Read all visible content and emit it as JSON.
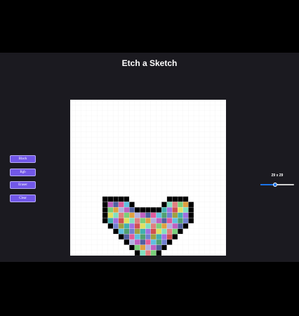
{
  "app": {
    "title": "Etch a Sketch"
  },
  "buttons": {
    "black": "Black",
    "rgb": "Rgb",
    "eraser": "Eraser",
    "clear": "Clear"
  },
  "grid": {
    "size_label": "29 x 29",
    "size": 29,
    "size_min": 1,
    "size_max": 64,
    "border_color": "#000000",
    "fill_colors": [
      "#e05a9a",
      "#7ad07a",
      "#a070e0",
      "#60c0e0",
      "#e0a040",
      "#d05050",
      "#50a070",
      "#b0b0e0",
      "#e0e060",
      "#7080d0",
      "#c060c0",
      "#80e0c0",
      "#a0a040",
      "#5060a0",
      "#e08080",
      "#40b0b0"
    ],
    "painted_rows": [
      {
        "row": 18,
        "border": [
          6,
          7,
          8,
          9,
          10,
          18,
          19,
          20,
          21
        ],
        "fill": []
      },
      {
        "row": 19,
        "border": [
          6,
          11,
          17,
          22
        ],
        "fill": [
          7,
          8,
          9,
          10,
          18,
          19,
          20,
          21
        ]
      },
      {
        "row": 20,
        "border": [
          6,
          12,
          13,
          14,
          15,
          16,
          22
        ],
        "fill": [
          7,
          8,
          9,
          10,
          11,
          17,
          18,
          19,
          20,
          21
        ]
      },
      {
        "row": 21,
        "border": [
          6,
          22
        ],
        "fill": [
          7,
          8,
          9,
          10,
          11,
          12,
          13,
          14,
          15,
          16,
          17,
          18,
          19,
          20,
          21
        ]
      },
      {
        "row": 22,
        "border": [
          6,
          22
        ],
        "fill": [
          7,
          8,
          9,
          10,
          11,
          12,
          13,
          14,
          15,
          16,
          17,
          18,
          19,
          20,
          21
        ]
      },
      {
        "row": 23,
        "border": [
          7,
          21
        ],
        "fill": [
          8,
          9,
          10,
          11,
          12,
          13,
          14,
          15,
          16,
          17,
          18,
          19,
          20
        ]
      },
      {
        "row": 24,
        "border": [
          8,
          20
        ],
        "fill": [
          9,
          10,
          11,
          12,
          13,
          14,
          15,
          16,
          17,
          18,
          19
        ]
      },
      {
        "row": 25,
        "border": [
          9,
          19
        ],
        "fill": [
          10,
          11,
          12,
          13,
          14,
          15,
          16,
          17,
          18
        ]
      },
      {
        "row": 26,
        "border": [
          10,
          18
        ],
        "fill": [
          11,
          12,
          13,
          14,
          15,
          16,
          17
        ]
      },
      {
        "row": 27,
        "border": [
          11,
          17
        ],
        "fill": [
          12,
          13,
          14,
          15,
          16
        ]
      },
      {
        "row": 28,
        "border": [
          12,
          16
        ],
        "fill": [
          13,
          14,
          15
        ]
      }
    ]
  }
}
